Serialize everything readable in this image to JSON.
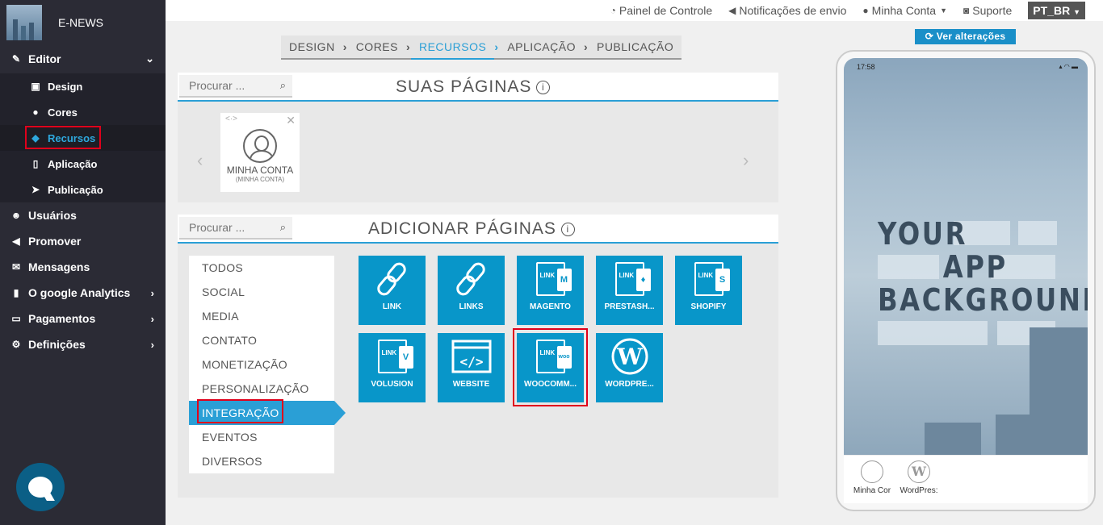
{
  "brand": {
    "name": "E-NEWS"
  },
  "sidebar": {
    "items": [
      {
        "label": "Editor",
        "icon": "pencil-icon",
        "expanded": true,
        "children": [
          {
            "label": "Design",
            "icon": "design-icon"
          },
          {
            "label": "Cores",
            "icon": "palette-icon"
          },
          {
            "label": "Recursos",
            "icon": "cube-icon"
          },
          {
            "label": "Aplicação",
            "icon": "mobile-icon"
          },
          {
            "label": "Publicação",
            "icon": "send-icon"
          }
        ]
      },
      {
        "label": "Usuários",
        "icon": "users-icon"
      },
      {
        "label": "Promover",
        "icon": "megaphone-icon"
      },
      {
        "label": "Mensagens",
        "icon": "envelope-icon"
      },
      {
        "label": "O google Analytics",
        "icon": "bar-chart-icon"
      },
      {
        "label": "Pagamentos",
        "icon": "credit-card-icon"
      },
      {
        "label": "Definições",
        "icon": "cogs-icon"
      }
    ]
  },
  "topbar": {
    "dashboard": "Painel de Controle",
    "notifications": "Notificações de envio",
    "account": "Minha Conta",
    "support": "Suporte",
    "language": "PT_BR"
  },
  "steps": [
    "DESIGN",
    "CORES",
    "RECURSOS",
    "APLICAÇÃO",
    "PUBLICAÇÃO"
  ],
  "active_step": "RECURSOS",
  "your_pages": {
    "search_placeholder": "Procurar ...",
    "title": "SUAS PÁGINAS",
    "cards": [
      {
        "title": "MINHA CONTA",
        "subtitle": "(MINHA CONTA)"
      }
    ]
  },
  "add_pages": {
    "search_placeholder": "Procurar ...",
    "title": "ADICIONAR PÁGINAS",
    "categories": [
      "TODOS",
      "SOCIAL",
      "MEDIA",
      "CONTATO",
      "MONETIZAÇÃO",
      "PERSONALIZAÇÃO",
      "INTEGRAÇÃO",
      "EVENTOS",
      "DIVERSOS"
    ],
    "active_category": "INTEGRAÇÃO",
    "tiles": [
      "LINK",
      "LINKS",
      "MAGENTO",
      "PRESTASH...",
      "SHOPIFY",
      "VOLUSION",
      "WEBSITE",
      "WOOCOMM...",
      "WORDPRE..."
    ]
  },
  "preview": {
    "button": "Ver alterações",
    "status_time": "17:58",
    "background_text": [
      "YOUR",
      "APP",
      "BACKGROUND"
    ],
    "tabs": [
      "Minha Cor",
      "WordPres:"
    ]
  }
}
